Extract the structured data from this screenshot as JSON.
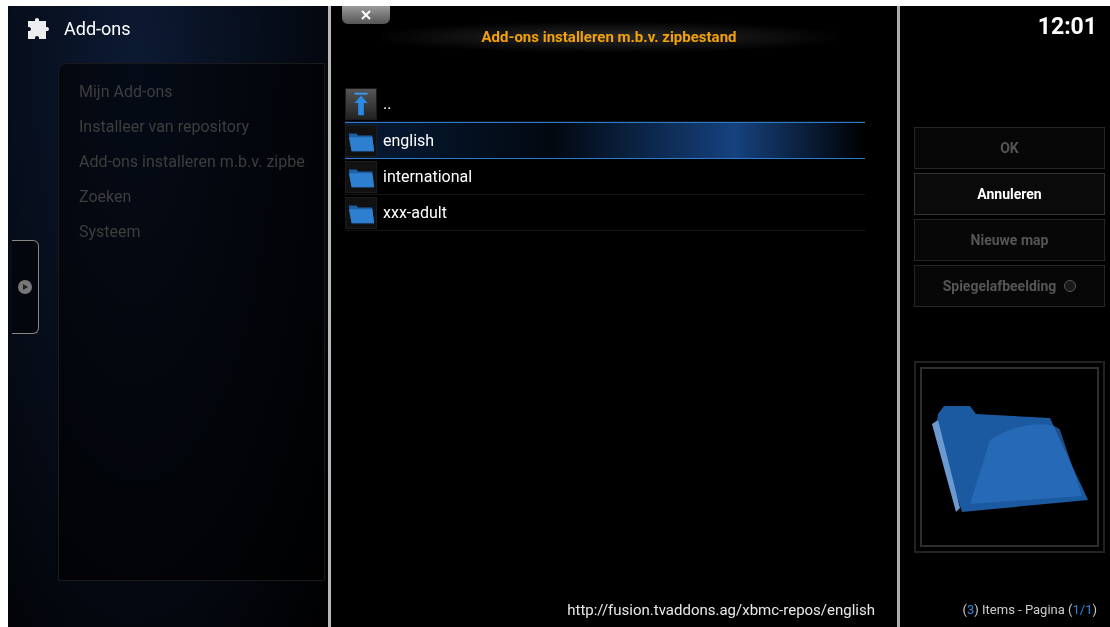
{
  "header": {
    "title": "Add-ons",
    "clock": "12:01"
  },
  "menu": {
    "items": [
      {
        "label": "Mijn Add-ons"
      },
      {
        "label": "Installeer van repository"
      },
      {
        "label": "Add-ons installeren m.b.v. zipbe"
      },
      {
        "label": "Zoeken"
      },
      {
        "label": "Systeem"
      }
    ]
  },
  "dialog": {
    "title": "Add-ons installeren m.b.v. zipbestand",
    "files": [
      {
        "kind": "parent",
        "name": "..",
        "selected": false
      },
      {
        "kind": "folder",
        "name": "english",
        "selected": true
      },
      {
        "kind": "folder",
        "name": "international",
        "selected": false
      },
      {
        "kind": "folder",
        "name": "xxx-adult",
        "selected": false
      }
    ],
    "path": "http://fusion.tvaddons.ag/xbmc-repos/english",
    "buttons": [
      {
        "kind": "plain",
        "label": "OK",
        "disabled": true,
        "focused": false
      },
      {
        "kind": "plain",
        "label": "Annuleren",
        "disabled": false,
        "focused": true
      },
      {
        "kind": "plain",
        "label": "Nieuwe map",
        "disabled": true,
        "focused": false
      },
      {
        "kind": "toggle",
        "label": "Spiegelafbeelding",
        "disabled": true,
        "focused": false,
        "on": false
      }
    ]
  },
  "status": {
    "parts": [
      {
        "text": "(",
        "highlight": false
      },
      {
        "text": "3",
        "highlight": true
      },
      {
        "text": ") Items - Pagina (",
        "highlight": false
      },
      {
        "text": "1/1",
        "highlight": true
      },
      {
        "text": ")",
        "highlight": false
      }
    ]
  }
}
